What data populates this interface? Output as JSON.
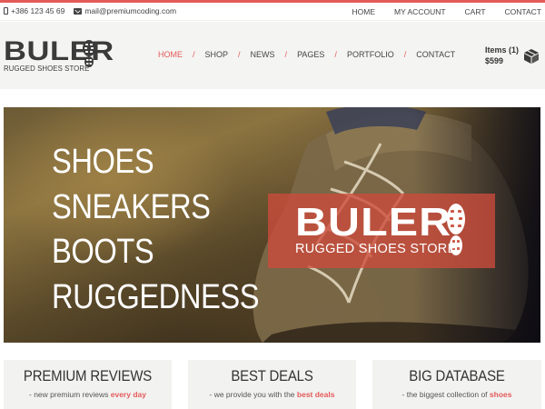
{
  "topbar": {
    "phone": "+386 123 45 69",
    "email": "mail@premiumcoding.com",
    "links": [
      "HOME",
      "MY ACCOUNT",
      "CART",
      "CONTACT"
    ]
  },
  "logo": {
    "word": "BULER",
    "tagline": "RUGGED SHOES STORE"
  },
  "nav": {
    "items": [
      "HOME",
      "SHOP",
      "NEWS",
      "PAGES",
      "PORTFOLIO",
      "CONTACT"
    ],
    "separator": "/",
    "active": "HOME"
  },
  "cart": {
    "items_label": "Items (1)",
    "total": "$599"
  },
  "hero": {
    "words": [
      "SHOES",
      "SNEAKERS",
      "BOOTS",
      "RUGGEDNESS"
    ],
    "brand_word": "BULER",
    "brand_tagline": "RUGGED SHOES STORE"
  },
  "cards": [
    {
      "title": "PREMIUM REVIEWS",
      "desc_prefix": "- new premium reviews ",
      "desc_highlight": "every day"
    },
    {
      "title": "BEST DEALS",
      "desc_prefix": "- we provide you with the ",
      "desc_highlight": "best deals"
    },
    {
      "title": "BIG DATABASE",
      "desc_prefix": "- the biggest collection of ",
      "desc_highlight": "shoes"
    }
  ],
  "colors": {
    "accent": "#e35a5a",
    "header_bg": "#f4f4f2",
    "brand_box": "#cd4b3c"
  },
  "icons": [
    "phone-icon",
    "mail-icon",
    "shoe-print-icon",
    "cart-box-icon"
  ]
}
